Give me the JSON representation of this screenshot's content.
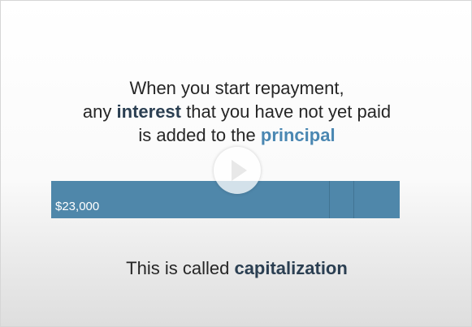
{
  "headline": {
    "line1": "When you start repayment,",
    "line2_prefix": "any ",
    "line2_highlight": "interest",
    "line2_suffix": " that you have not yet paid",
    "line3_prefix": "is added to the ",
    "line3_highlight": "principal"
  },
  "bar": {
    "label": "$23,000",
    "color": "#4f87aa"
  },
  "footer": {
    "prefix": "This is called ",
    "highlight": "capitalization"
  },
  "colors": {
    "highlight_dark": "#2b3f52",
    "highlight_blue": "#4a87b2",
    "text": "#262626"
  },
  "play_button": {
    "icon": "play-icon"
  }
}
